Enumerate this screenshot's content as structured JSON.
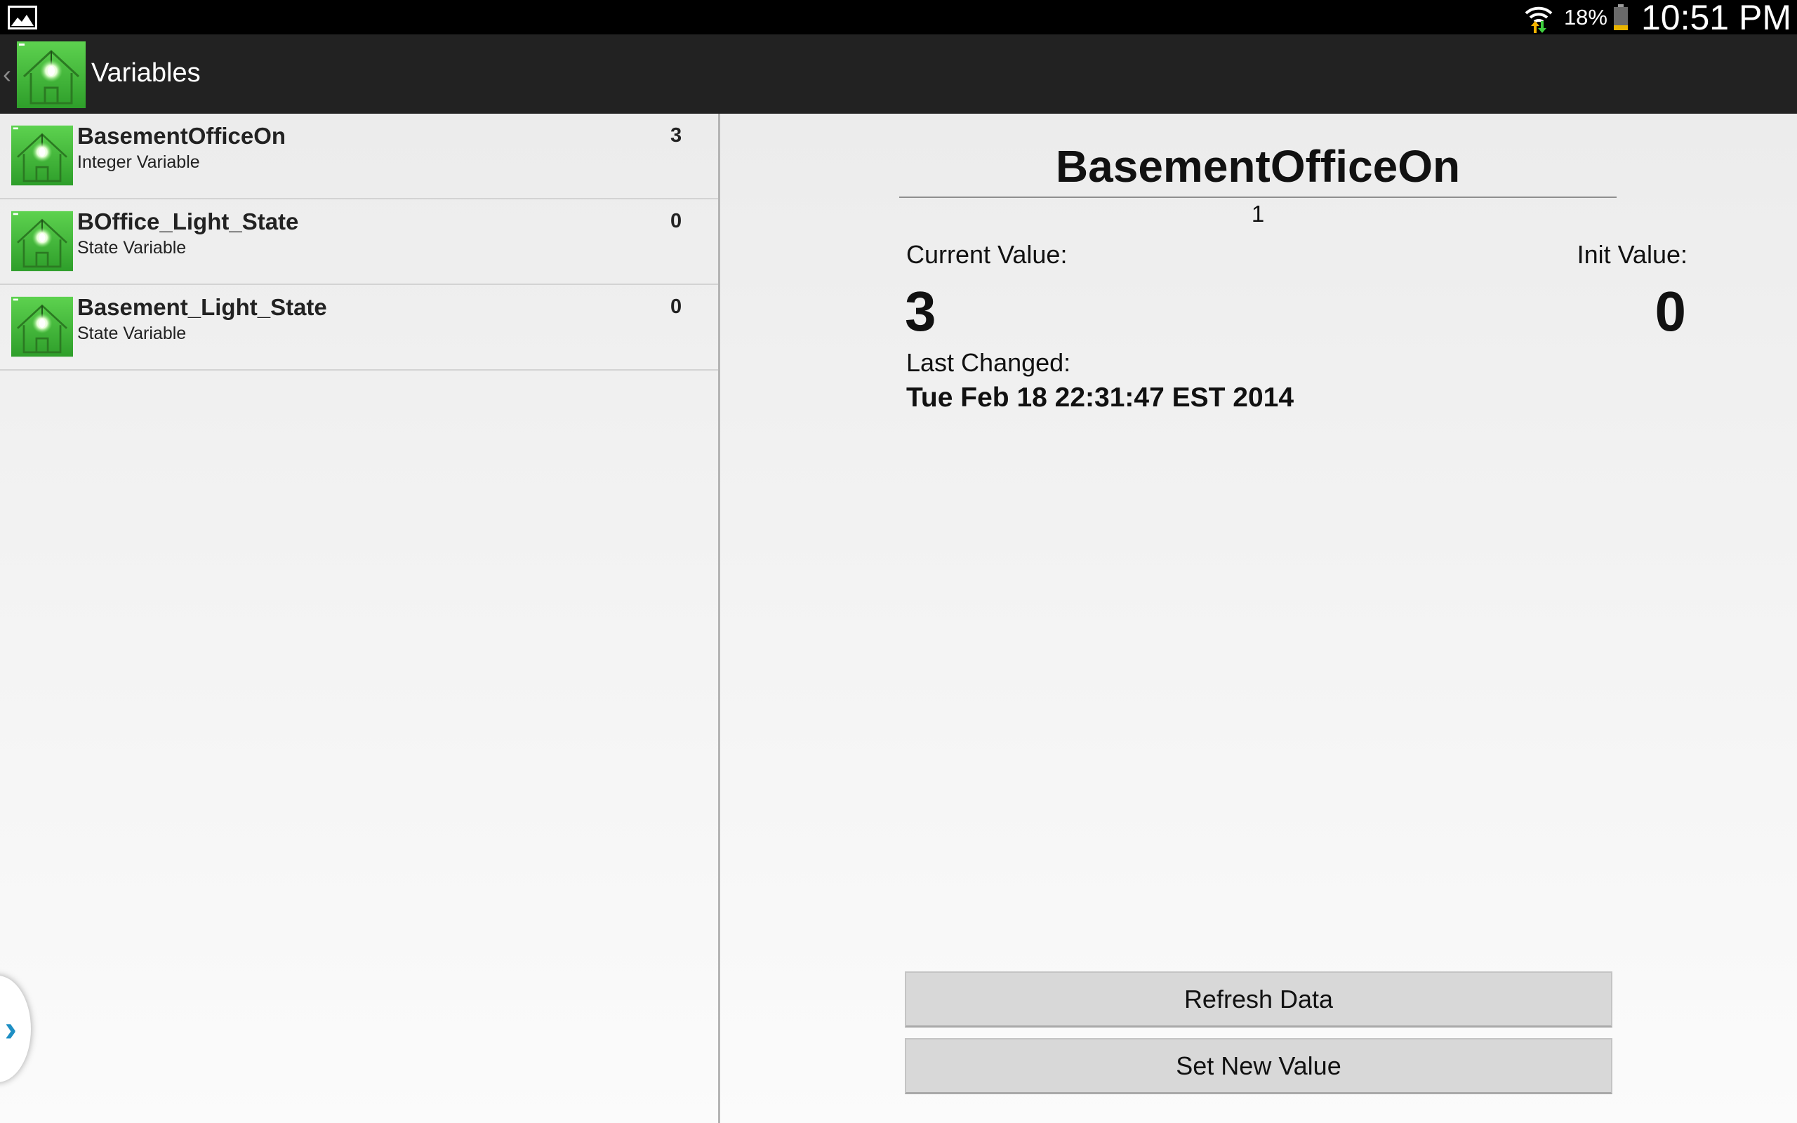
{
  "status_bar": {
    "battery_percent": "18%",
    "clock": "10:51 PM",
    "icons": [
      "image-notification-icon",
      "wifi-icon",
      "battery-icon"
    ]
  },
  "action_bar": {
    "title": "Variables",
    "icon": "house-bulb-icon"
  },
  "variables": [
    {
      "name": "BasementOfficeOn",
      "type": "Integer Variable",
      "value": "3"
    },
    {
      "name": "BOffice_Light_State",
      "type": "State Variable",
      "value": "0"
    },
    {
      "name": "Basement_Light_State",
      "type": "State Variable",
      "value": "0"
    }
  ],
  "detail": {
    "title": "BasementOfficeOn",
    "subtitle": "1",
    "current_label": "Current Value:",
    "current_value": "3",
    "init_label": "Init Value:",
    "init_value": "0",
    "last_changed_label": "Last Changed:",
    "last_changed_value": "Tue Feb 18 22:31:47 EST 2014",
    "refresh_label": "Refresh Data",
    "set_label": "Set New Value"
  },
  "colors": {
    "accent_green": "#45c23a",
    "drawer_chevron": "#1e8fc4"
  }
}
